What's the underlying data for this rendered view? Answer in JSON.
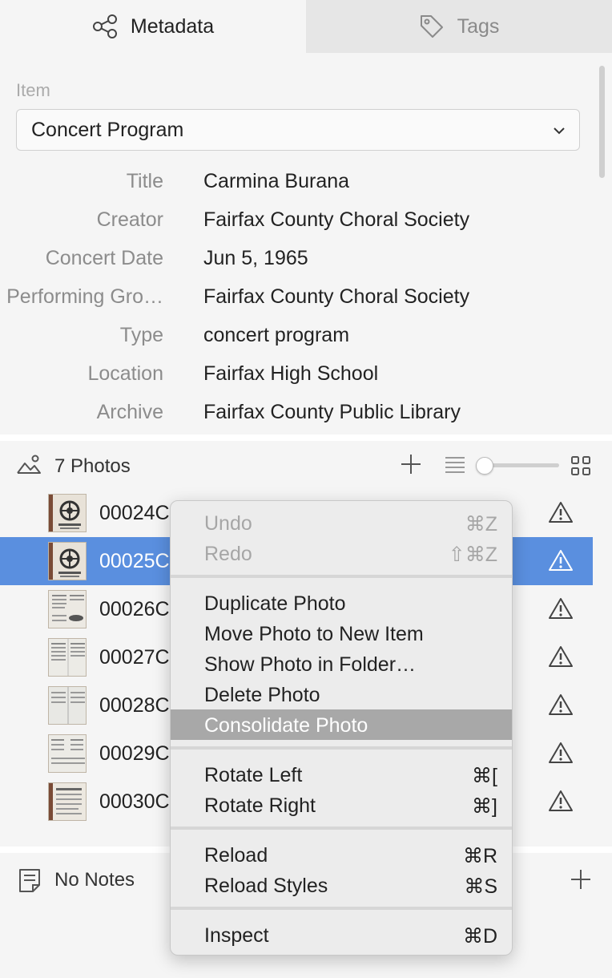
{
  "tabs": [
    {
      "label": "Metadata",
      "icon": "share-icon",
      "active": true
    },
    {
      "label": "Tags",
      "icon": "tag-icon",
      "active": false
    }
  ],
  "metadata": {
    "item_label": "Item",
    "item_type": "Concert Program",
    "fields": [
      {
        "label": "Title",
        "value": "Carmina Burana"
      },
      {
        "label": "Creator",
        "value": "Fairfax County Choral Society"
      },
      {
        "label": "Concert Date",
        "value": "Jun 5, 1965"
      },
      {
        "label": "Performing Gro…",
        "value": "Fairfax County Choral Society"
      },
      {
        "label": "Type",
        "value": "concert program"
      },
      {
        "label": "Location",
        "value": "Fairfax High School"
      },
      {
        "label": "Archive",
        "value": "Fairfax County Public Library"
      }
    ]
  },
  "photos": {
    "title": "7 Photos",
    "items": [
      {
        "name": "00024C",
        "selected": false
      },
      {
        "name": "00025C",
        "selected": true
      },
      {
        "name": "00026C",
        "selected": false
      },
      {
        "name": "00027C",
        "selected": false
      },
      {
        "name": "00028C",
        "selected": false
      },
      {
        "name": "00029C",
        "selected": false
      },
      {
        "name": "00030C",
        "selected": false
      }
    ]
  },
  "notes": {
    "title": "No Notes"
  },
  "context_menu": {
    "groups": [
      [
        {
          "label": "Undo",
          "shortcut": "⌘Z",
          "disabled": true
        },
        {
          "label": "Redo",
          "shortcut": "⇧⌘Z",
          "disabled": true
        }
      ],
      [
        {
          "label": "Duplicate Photo",
          "shortcut": ""
        },
        {
          "label": "Move Photo to New Item",
          "shortcut": ""
        },
        {
          "label": "Show Photo in Folder…",
          "shortcut": ""
        },
        {
          "label": "Delete Photo",
          "shortcut": ""
        },
        {
          "label": "Consolidate Photo",
          "shortcut": "",
          "highlighted": true
        }
      ],
      [
        {
          "label": "Rotate Left",
          "shortcut": "⌘["
        },
        {
          "label": "Rotate Right",
          "shortcut": "⌘]"
        }
      ],
      [
        {
          "label": "Reload",
          "shortcut": "⌘R"
        },
        {
          "label": "Reload Styles",
          "shortcut": "⌘S"
        }
      ],
      [
        {
          "label": "Inspect",
          "shortcut": "⌘D"
        }
      ]
    ]
  },
  "colors": {
    "selection": "#5a8fdf",
    "menu_highlight": "#a8a8a8"
  }
}
